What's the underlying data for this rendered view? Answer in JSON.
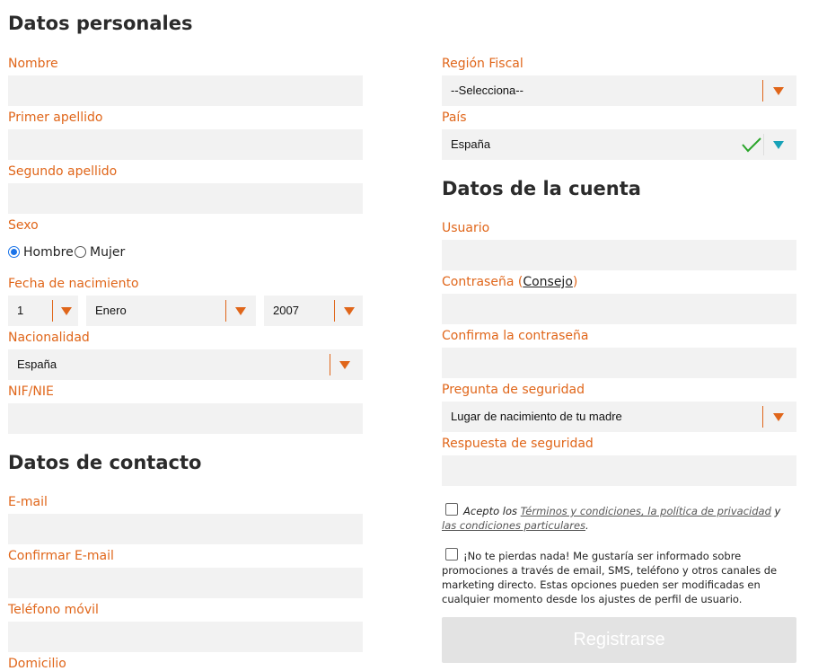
{
  "personal": {
    "heading": "Datos personales",
    "nombre_label": "Nombre",
    "apellido1_label": "Primer apellido",
    "apellido2_label": "Segundo apellido",
    "sexo_label": "Sexo",
    "sexo_options": [
      "Hombre",
      "Mujer"
    ],
    "sexo_selected": "Hombre",
    "nacimiento_label": "Fecha de nacimiento",
    "dia": "1",
    "mes": "Enero",
    "anio": "2007",
    "nacionalidad_label": "Nacionalidad",
    "nacionalidad_value": "España",
    "nif_label": "NIF/NIE"
  },
  "contact": {
    "heading": "Datos de contacto",
    "email_label": "E-mail",
    "email_confirm_label": "Confirmar E-mail",
    "telefono_label": "Teléfono móvil",
    "domicilio_label": "Domicilio"
  },
  "region": {
    "region_label": "Región Fiscal",
    "region_value": "--Selecciona--",
    "pais_label": "País",
    "pais_value": "España"
  },
  "account": {
    "heading": "Datos de la cuenta",
    "usuario_label": "Usuario",
    "password_label_pre": "Contraseña (",
    "password_hint_link": "Consejo",
    "password_label_post": ")",
    "password_confirm_label": "Confirma la contraseña",
    "pregunta_label": "Pregunta de seguridad",
    "pregunta_value": "Lugar de nacimiento de tu madre",
    "respuesta_label": "Respuesta de seguridad"
  },
  "terms": {
    "acepto": "Acepto los ",
    "link1": "Términos y condiciones, la política de privacidad",
    "y": " y ",
    "link2": "las condiciones particulares",
    "dot": "."
  },
  "marketing": {
    "text": "¡No te pierdas nada! Me gustaría ser informado sobre promociones a través de email, SMS, teléfono y otros canales de marketing directo. Estas opciones pueden ser modificadas en cualquier momento desde los ajustes de perfil de usuario."
  },
  "submit_label": "Registrarse",
  "colors": {
    "accent": "#e0661a",
    "field_bg": "#f2f2f2",
    "valid": "#2aa52a",
    "teal": "#17a2b8"
  }
}
